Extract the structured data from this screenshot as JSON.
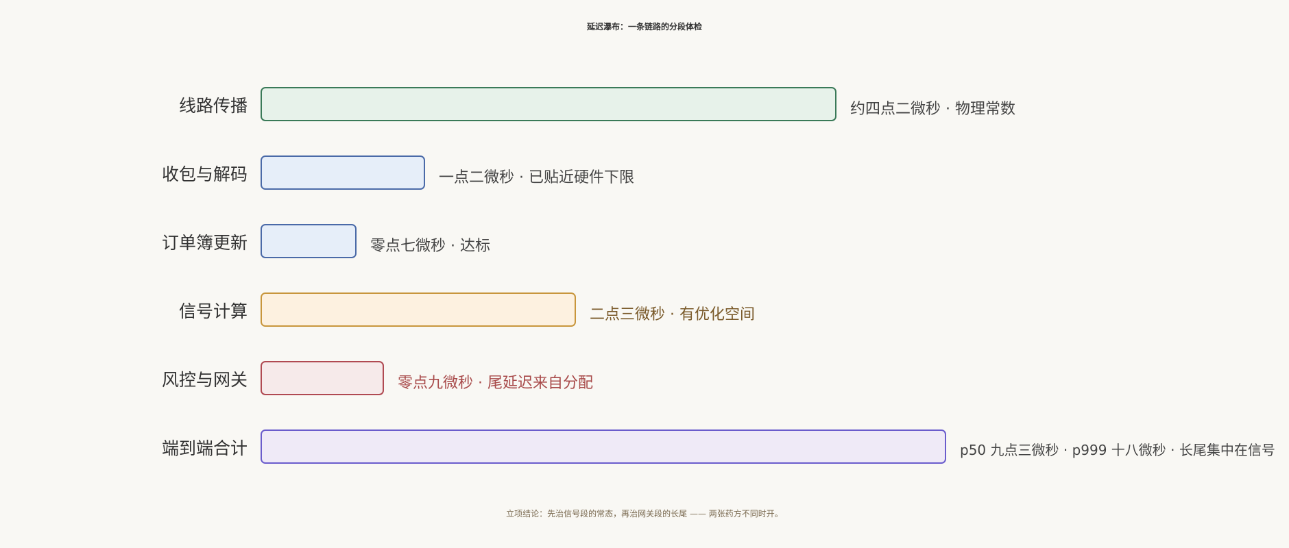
{
  "title": "延迟瀑布：一条链路的分段体检",
  "segments": [
    {
      "label": "线路传播",
      "note": "约四点二微秒 · 物理常数",
      "value_us": 4.2,
      "fill": "#e7f2ea",
      "stroke": "#3a7a58",
      "note_color": "#444444"
    },
    {
      "label": "收包与解码",
      "note": "一点二微秒 · 已贴近硬件下限",
      "value_us": 1.2,
      "fill": "#e6eef9",
      "stroke": "#4a6aa8",
      "note_color": "#444444"
    },
    {
      "label": "订单簿更新",
      "note": "零点七微秒 · 达标",
      "value_us": 0.7,
      "fill": "#e6eef9",
      "stroke": "#4a6aa8",
      "note_color": "#444444"
    },
    {
      "label": "信号计算",
      "note": "二点三微秒 · 有优化空间",
      "value_us": 2.3,
      "fill": "#fdf1e0",
      "stroke": "#c8963c",
      "note_color": "#7a5a2a"
    },
    {
      "label": "风控与网关",
      "note": "零点九微秒 · 尾延迟来自分配",
      "value_us": 0.9,
      "fill": "#f6eaea",
      "stroke": "#b04a52",
      "note_color": "#a84a4a"
    },
    {
      "label": "端到端合计",
      "note": "p50 九点三微秒 · p999 十八微秒 · 长尾集中在信号",
      "value_us": 5.0,
      "fill": "#efeaf7",
      "stroke": "#6a5ccc",
      "note_color": "#444444"
    }
  ],
  "footer": "立项结论：先治信号段的常态，再治网关段的长尾 —— 两张药方不同时开。"
}
